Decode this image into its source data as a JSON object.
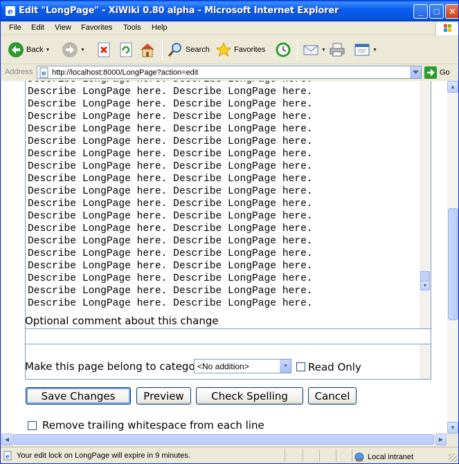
{
  "window": {
    "title": "Edit \"LongPage\" - XiWiki 0.80 alpha - Microsoft Internet Explorer",
    "minimize": "_",
    "maximize": "□",
    "close": "✕"
  },
  "menu": [
    "File",
    "Edit",
    "View",
    "Favorites",
    "Tools",
    "Help"
  ],
  "toolbar": {
    "back_label": "Back",
    "search_label": "Search",
    "favorites_label": "Favorites"
  },
  "address": {
    "label": "Address",
    "url": "http://localhost:8000/LongPage?action=edit",
    "go_label": "Go"
  },
  "editor": {
    "line_text": "Describe LongPage here. Describe LongPage here.",
    "line_count": 18
  },
  "form": {
    "comment_label": "Optional comment about this change",
    "comment_value": "",
    "category_label": "Make this page belong to category",
    "category_selected": "<No addition>",
    "read_only_label": "Read Only",
    "read_only_checked": false,
    "buttons": {
      "save": "Save Changes",
      "preview": "Preview",
      "spell": "Check Spelling",
      "cancel": "Cancel"
    },
    "trim_label": "Remove trailing whitespace from each line",
    "trim_checked": false
  },
  "status": {
    "message": "Your edit lock on LongPage will expire in 9 minutes.",
    "zone": "Local intranet"
  }
}
